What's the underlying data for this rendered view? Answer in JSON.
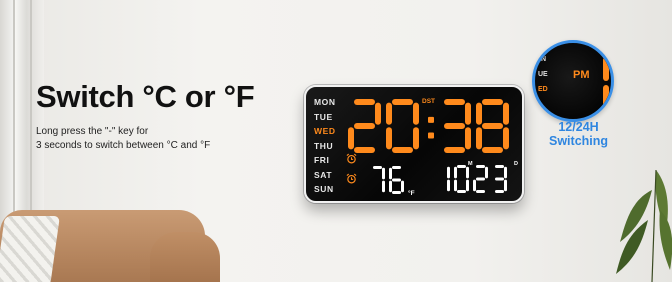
{
  "headline": "Switch °C or °F",
  "description": {
    "line1": "Long press the \"-\" key for",
    "line2": "3 seconds to switch between °C and °F"
  },
  "clock": {
    "days": [
      "MON",
      "TUE",
      "WED",
      "THU",
      "FRI",
      "SAT",
      "SUN"
    ],
    "active_day": "WED",
    "dst_label": "DST",
    "time": "20:38",
    "temperature": "76",
    "temperature_unit": "°F",
    "date": "1023",
    "month_tag": "M",
    "day_tag": "D",
    "colors": {
      "led_orange": "#ff8a1c",
      "led_white": "#ffffff",
      "face": "#0a0a0a"
    }
  },
  "zoom": {
    "pm_label": "PM",
    "partial_days": [
      "N",
      "UE",
      "ED"
    ],
    "caption_line1": "12/24H",
    "caption_line2": "Switching",
    "accent_color": "#3a8fe6"
  },
  "icons": [
    "alarm-clock-icon"
  ]
}
